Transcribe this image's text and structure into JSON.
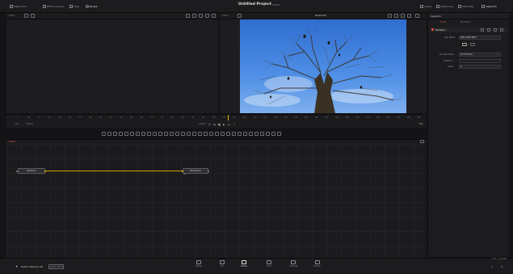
{
  "topbar": {
    "items": [
      {
        "label": "Media Pool"
      },
      {
        "label": "Effects Library"
      },
      {
        "label": "Clips"
      },
      {
        "label": "Nodes"
      }
    ],
    "project_title": "Untitled Project",
    "project_status": "Edited",
    "right_items": [
      {
        "label": "Spline"
      },
      {
        "label": "Keyframes"
      },
      {
        "label": "Metadata"
      },
      {
        "label": "Inspector"
      }
    ]
  },
  "viewers": {
    "left_zoom": "100%",
    "right_zoom": "100%",
    "right_title": "MediaOut1"
  },
  "transport": {
    "start_frame": "0.0",
    "duration": "1000.0",
    "render_range": "1000.0",
    "current_frame": "0.0"
  },
  "timeline_ruler": {
    "ticks": [
      "0",
      "5",
      "10",
      "15",
      "20",
      "25",
      "30",
      "35",
      "40",
      "45",
      "50",
      "55",
      "60",
      "65",
      "70",
      "75",
      "80",
      "85",
      "90",
      "95",
      "100",
      "105",
      "110",
      "115",
      "120",
      "125",
      "130",
      "135",
      "140",
      "145",
      "150",
      "155",
      "160",
      "165",
      "170",
      "175",
      "180",
      "185",
      "190",
      "195",
      "200"
    ]
  },
  "nodes_panel": {
    "label": "Nodes",
    "node_in": "MediaIn1",
    "node_out": "MediaOut1"
  },
  "inspector": {
    "title": "Inspector",
    "tab_tools": "Tools",
    "tab_modifiers": "Modifiers",
    "node_name": "MediaIn1",
    "clip_name_label": "Clip Name",
    "clip_name_value": "IMG_0326.MOV",
    "process_mode_label": "Process Mode",
    "process_mode_value": "Full Frames",
    "global_in_label": "Global In",
    "layer_label": "Layer",
    "layer_value": "0"
  },
  "bottombar": {
    "app_name": "DaVinci Resolve 18",
    "beta_label": "PUBLIC BETA",
    "pages": [
      {
        "label": "Media"
      },
      {
        "label": "Cut"
      },
      {
        "label": "Fusion"
      },
      {
        "label": "Color"
      },
      {
        "label": "Fairlight"
      },
      {
        "label": "Deliver"
      }
    ],
    "status_text": "12% – 1.00 GB"
  },
  "colors": {
    "accent": "#f0b400",
    "active_tab": "#c8402c",
    "background": "#141416",
    "panel": "#1d1d20"
  }
}
